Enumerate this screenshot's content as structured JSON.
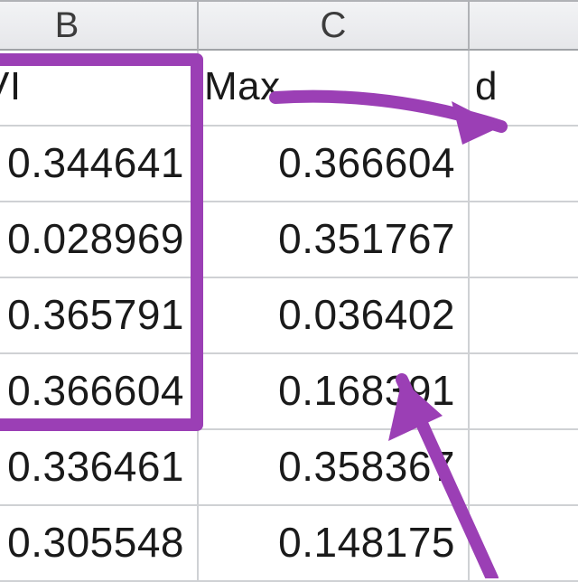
{
  "columns": {
    "B": {
      "letter": "B",
      "header": "IDVI"
    },
    "C": {
      "letter": "C",
      "header": "Max"
    },
    "D": {
      "letter": "",
      "header": "d"
    }
  },
  "rows": {
    "B": [
      "0.344641",
      "0.028969",
      "0.365791",
      "0.366604",
      "0.336461",
      "0.305548"
    ],
    "C": [
      "0.366604",
      "0.351767",
      "0.036402",
      "0.168391",
      "0.358367",
      "0.148175"
    ],
    "D": [
      "",
      "",
      "",
      "",
      "",
      ""
    ]
  },
  "annotations": {
    "selection_box": "B1:B4 boxed",
    "arrow_top": "arrow from C header toward column D",
    "arrow_bottom": "arrow pointing up into C4"
  }
}
